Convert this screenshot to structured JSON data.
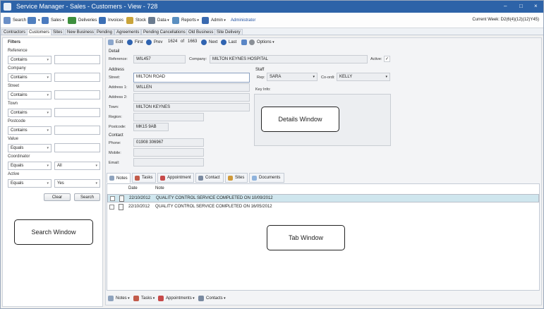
{
  "titlebar": {
    "title": "Service Manager - Sales - Customers - View - 728"
  },
  "menubar": {
    "items": [
      {
        "label": "Search",
        "color": "#6a8fc7"
      },
      {
        "label": "",
        "color": "#4f7fbf"
      },
      {
        "label": "Sales",
        "color": "#4a7abf"
      },
      {
        "label": "Deliveries",
        "color": "#3d8f3d"
      },
      {
        "label": "Invoices",
        "color": "#3b6fb5"
      },
      {
        "label": "Stock",
        "color": "#c9a43a"
      },
      {
        "label": "Data",
        "color": "#6a7b8f"
      },
      {
        "label": "Reports",
        "color": "#5a8fc0"
      },
      {
        "label": "Admin",
        "color": "#3a6ab0"
      }
    ],
    "user": "Administrator",
    "current_week": "Current Week: D2(6(4)(12)(12)Y45)"
  },
  "main_tabs": [
    "Contractors",
    "Customers",
    "Sites",
    "New Business",
    "Pending",
    "Agreements",
    "Pending Cancellations",
    "Old Business",
    "Site Delivery"
  ],
  "filters": {
    "heading": "Filters",
    "rows": [
      {
        "label": "Reference",
        "op": "Contains",
        "value": ""
      },
      {
        "label": "Company",
        "op": "Contains",
        "value": ""
      },
      {
        "label": "Street",
        "op": "Contains",
        "value": ""
      },
      {
        "label": "Town",
        "op": "Contains",
        "value": ""
      },
      {
        "label": "Postcode",
        "op": "Contains",
        "value": ""
      },
      {
        "label": "Value",
        "op": "Equals",
        "value": ""
      },
      {
        "label": "Coordinator",
        "op": "Equals",
        "value": "All"
      },
      {
        "label": "Active",
        "op": "Equals",
        "value": "Yes"
      }
    ],
    "clear": "Clear",
    "search": "Search",
    "callout": "Search Window"
  },
  "record_toolbar": {
    "edit": "Edit",
    "first": "First",
    "prev": "Prev",
    "pos": "1624",
    "of": "of",
    "total": "1663",
    "next": "Next",
    "last": "Last",
    "options": "Options"
  },
  "detail": {
    "section": "Detail",
    "reference_label": "Reference:",
    "reference": "WIL457",
    "company_label": "Company:",
    "company": "MILTON KEYNES HOSPITAL",
    "active_label": "Active:",
    "address_section": "Address",
    "street_label": "Street:",
    "street": "MILTON ROAD",
    "addr1_label": "Address 1:",
    "addr1": "WILLEN",
    "addr2_label": "Address 2:",
    "addr2": "",
    "town_label": "Town:",
    "town": "MILTON KEYNES",
    "region_label": "Region:",
    "region": "",
    "postcode_label": "Postcode:",
    "postcode": "MK15 9AB",
    "contact_section": "Contact",
    "phone_label": "Phone:",
    "phone": "01908 306967",
    "mobile_label": "Mobile:",
    "mobile": "",
    "email_label": "Email:",
    "email": "",
    "staff_section": "Staff",
    "rep_label": "Rep:",
    "rep": "SARA",
    "coord_label": "Co-ordi:",
    "coord": "KELLY",
    "keyinfo_label": "Key Info:",
    "callout": "Details Window"
  },
  "sub_tabs": [
    "Notes",
    "Tasks",
    "Appointment",
    "Contact",
    "Sites",
    "Documents"
  ],
  "notes": {
    "headers": [
      "Date",
      "Note"
    ],
    "rows": [
      {
        "date": "22/10/2012",
        "note": "QUALITY CONTROL SERVICE COMPLETED ON 10/09/2012"
      },
      {
        "date": "22/10/2012",
        "note": "QUALITY CONTROL SERVICE COMPLETED ON 16/05/2012"
      }
    ],
    "callout": "Tab Window"
  },
  "bottom_toolbar": [
    "Notes",
    "Tasks",
    "Appointments",
    "Contacts"
  ]
}
